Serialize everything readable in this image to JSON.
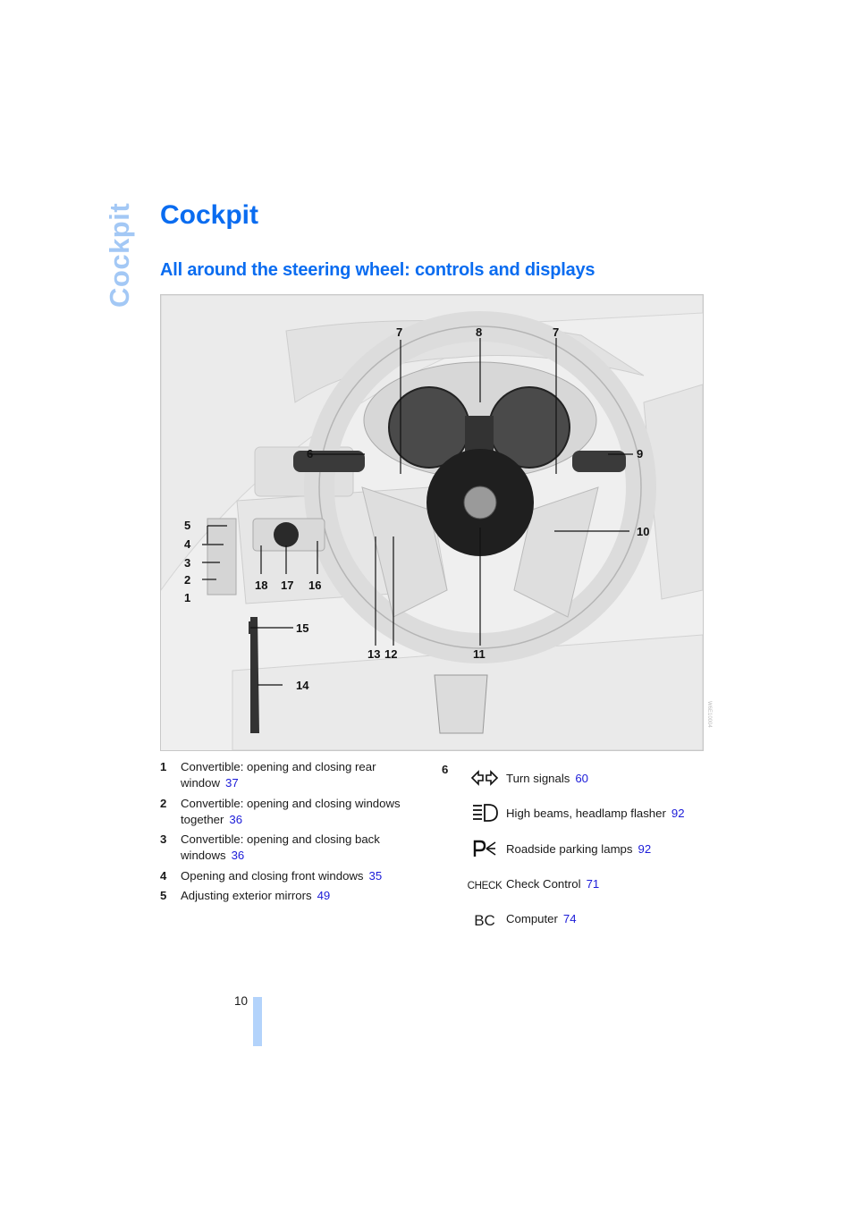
{
  "side_tab": "Cockpit",
  "title": "Cockpit",
  "subtitle": "All around the steering wheel: controls and displays",
  "colors": {
    "heading": "#0a6cf0",
    "side_tab": "#a3c8f5",
    "page_ref": "#1b1bd8",
    "page_bar": "#b3d3fb"
  },
  "figure": {
    "description": "Illustration of car cockpit around steering wheel with numbered callouts",
    "callouts": [
      "1",
      "2",
      "3",
      "4",
      "5",
      "6",
      "7",
      "7",
      "8",
      "9",
      "10",
      "11",
      "12",
      "13",
      "14",
      "15",
      "16",
      "17",
      "18"
    ],
    "code": "W6E10004"
  },
  "legend_left": [
    {
      "num": "1",
      "text": "Convertible: opening and closing rear window",
      "page": "37"
    },
    {
      "num": "2",
      "text": "Convertible: opening and closing windows together",
      "page": "36"
    },
    {
      "num": "3",
      "text": "Convertible: opening and closing back windows",
      "page": "36"
    },
    {
      "num": "4",
      "text": "Opening and closing front windows",
      "page": "35"
    },
    {
      "num": "5",
      "text": "Adjusting exterior mirrors",
      "page": "49"
    }
  ],
  "legend_right": {
    "num": "6",
    "items": [
      {
        "icon": "turn-signals-icon",
        "text": "Turn signals",
        "page": "60"
      },
      {
        "icon": "high-beams-icon",
        "text": "High beams, headlamp flasher",
        "page": "92"
      },
      {
        "icon": "parking-lamps-icon",
        "text": "Roadside parking lamps",
        "page": "92"
      },
      {
        "icon": "check-control-icon",
        "icon_text": "CHECK",
        "text": "Check Control",
        "page": "71"
      },
      {
        "icon": "computer-icon",
        "icon_text": "BC",
        "text": "Computer",
        "page": "74"
      }
    ]
  },
  "page_number": "10"
}
